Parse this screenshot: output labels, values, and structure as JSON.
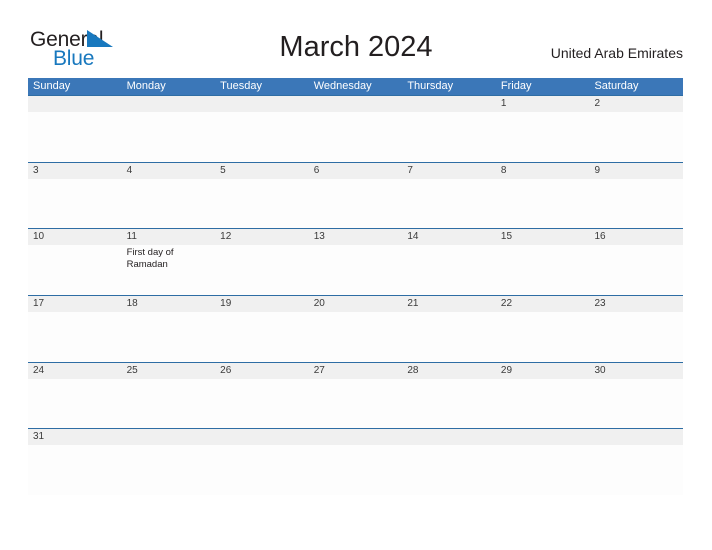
{
  "brand": {
    "logo_text_1": "General",
    "logo_text_2": "Blue",
    "logo_icon": "flag-triangle-icon",
    "color_dark": "#231f20",
    "color_blue": "#1878be"
  },
  "header": {
    "title": "March 2024",
    "region": "United Arab Emirates"
  },
  "theme": {
    "header_bar_color": "#3b77b8",
    "row_rule_color": "#2e6da4",
    "daynum_band_color": "#f0f0f0",
    "cell_background": "#fdfdfd",
    "text_color": "#231f20"
  },
  "calendar": {
    "month": "March",
    "year": "2024",
    "weekday_headers": [
      "Sunday",
      "Monday",
      "Tuesday",
      "Wednesday",
      "Thursday",
      "Friday",
      "Saturday"
    ],
    "weeks": [
      {
        "days": [
          {
            "num": "",
            "event": ""
          },
          {
            "num": "",
            "event": ""
          },
          {
            "num": "",
            "event": ""
          },
          {
            "num": "",
            "event": ""
          },
          {
            "num": "",
            "event": ""
          },
          {
            "num": "1",
            "event": ""
          },
          {
            "num": "2",
            "event": ""
          }
        ]
      },
      {
        "days": [
          {
            "num": "3",
            "event": ""
          },
          {
            "num": "4",
            "event": ""
          },
          {
            "num": "5",
            "event": ""
          },
          {
            "num": "6",
            "event": ""
          },
          {
            "num": "7",
            "event": ""
          },
          {
            "num": "8",
            "event": ""
          },
          {
            "num": "9",
            "event": ""
          }
        ]
      },
      {
        "days": [
          {
            "num": "10",
            "event": ""
          },
          {
            "num": "11",
            "event": "First day of Ramadan"
          },
          {
            "num": "12",
            "event": ""
          },
          {
            "num": "13",
            "event": ""
          },
          {
            "num": "14",
            "event": ""
          },
          {
            "num": "15",
            "event": ""
          },
          {
            "num": "16",
            "event": ""
          }
        ]
      },
      {
        "days": [
          {
            "num": "17",
            "event": ""
          },
          {
            "num": "18",
            "event": ""
          },
          {
            "num": "19",
            "event": ""
          },
          {
            "num": "20",
            "event": ""
          },
          {
            "num": "21",
            "event": ""
          },
          {
            "num": "22",
            "event": ""
          },
          {
            "num": "23",
            "event": ""
          }
        ]
      },
      {
        "days": [
          {
            "num": "24",
            "event": ""
          },
          {
            "num": "25",
            "event": ""
          },
          {
            "num": "26",
            "event": ""
          },
          {
            "num": "27",
            "event": ""
          },
          {
            "num": "28",
            "event": ""
          },
          {
            "num": "29",
            "event": ""
          },
          {
            "num": "30",
            "event": ""
          }
        ]
      },
      {
        "days": [
          {
            "num": "31",
            "event": ""
          },
          {
            "num": "",
            "event": ""
          },
          {
            "num": "",
            "event": ""
          },
          {
            "num": "",
            "event": ""
          },
          {
            "num": "",
            "event": ""
          },
          {
            "num": "",
            "event": ""
          },
          {
            "num": "",
            "event": ""
          }
        ]
      }
    ]
  }
}
